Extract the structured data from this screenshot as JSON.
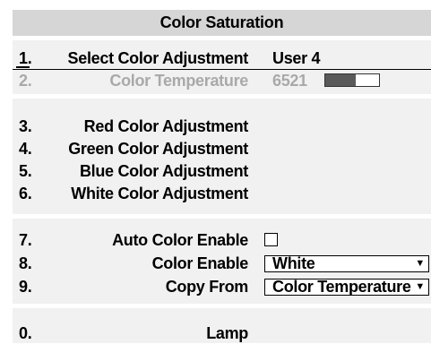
{
  "window": {
    "title": "Color Saturation"
  },
  "menu": {
    "items": [
      {
        "num": "1.",
        "label": "Select Color Adjustment",
        "value": "User 4",
        "enabled": true,
        "selected": true
      },
      {
        "num": "2.",
        "label": "Color Temperature",
        "value": "6521",
        "enabled": false,
        "slider_level": 0.56
      },
      {
        "num": "3.",
        "label": "Red Color Adjustment"
      },
      {
        "num": "4.",
        "label": "Green Color Adjustment"
      },
      {
        "num": "5.",
        "label": "Blue Color Adjustment"
      },
      {
        "num": "6.",
        "label": "White Color Adjustment"
      },
      {
        "num": "7.",
        "label": "Auto Color Enable",
        "checked": false
      },
      {
        "num": "8.",
        "label": "Color Enable",
        "value": "White"
      },
      {
        "num": "9.",
        "label": "Copy From",
        "value": "Color Temperature"
      },
      {
        "num": "0.",
        "label": "Lamp"
      }
    ]
  },
  "icons": {
    "dropdown_arrow": "▼"
  }
}
